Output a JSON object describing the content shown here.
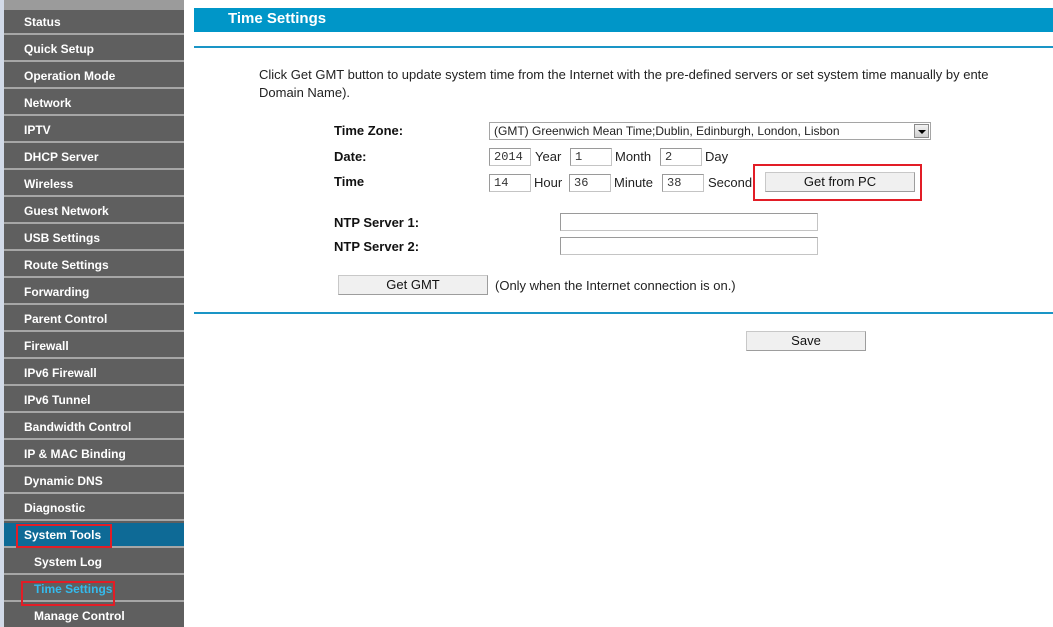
{
  "sidebar": {
    "items": [
      {
        "label": "Status"
      },
      {
        "label": "Quick Setup"
      },
      {
        "label": "Operation Mode"
      },
      {
        "label": "Network"
      },
      {
        "label": "IPTV"
      },
      {
        "label": "DHCP Server"
      },
      {
        "label": "Wireless"
      },
      {
        "label": "Guest Network"
      },
      {
        "label": "USB Settings"
      },
      {
        "label": "Route Settings"
      },
      {
        "label": "Forwarding"
      },
      {
        "label": "Parent Control"
      },
      {
        "label": "Firewall"
      },
      {
        "label": "IPv6 Firewall"
      },
      {
        "label": "IPv6 Tunnel"
      },
      {
        "label": "Bandwidth Control"
      },
      {
        "label": "IP & MAC Binding"
      },
      {
        "label": "Dynamic DNS"
      },
      {
        "label": "Diagnostic"
      },
      {
        "label": "System Tools",
        "active": true
      },
      {
        "label": "System Log",
        "sub": true
      },
      {
        "label": "Time Settings",
        "sub": true,
        "active": true
      },
      {
        "label": "Manage Control",
        "sub": true
      }
    ]
  },
  "page": {
    "title": "Time Settings",
    "description_line1": "Click Get GMT button to update system time from the Internet with the pre-defined servers or set system time manually by ente",
    "description_line2": "Domain Name)."
  },
  "form": {
    "time_zone_label": "Time Zone:",
    "time_zone_value": "(GMT) Greenwich Mean Time;Dublin, Edinburgh, London, Lisbon",
    "date_label": "Date:",
    "year_value": "2014",
    "year_unit": "Year",
    "month_value": "1",
    "month_unit": "Month",
    "day_value": "2",
    "day_unit": "Day",
    "time_label": "Time",
    "hour_value": "14",
    "hour_unit": "Hour",
    "minute_value": "36",
    "minute_unit": "Minute",
    "second_value": "38",
    "second_unit": "Second",
    "get_from_pc_label": "Get from PC",
    "ntp1_label": "NTP Server 1:",
    "ntp1_value": "",
    "ntp2_label": "NTP Server 2:",
    "ntp2_value": "",
    "get_gmt_label": "Get GMT",
    "get_gmt_note": "(Only when the Internet connection is on.)",
    "save_label": "Save"
  },
  "colors": {
    "accent": "#0096c8",
    "sidebar_bg": "#5f5f5f",
    "sidebar_active": "#0e6a96",
    "active_child_text": "#33bbee",
    "highlight": "#e21d26"
  }
}
